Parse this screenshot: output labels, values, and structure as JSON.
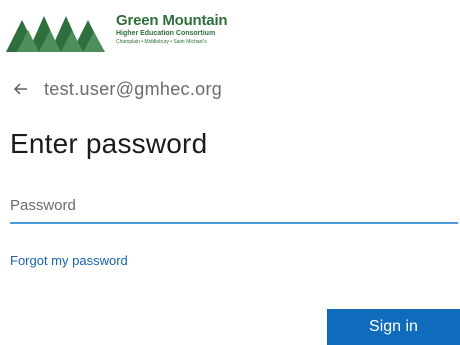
{
  "logo": {
    "name": "Green Mountain",
    "subtitle": "Higher Education Consortium",
    "tagline": "Champlain • Middlebury • Saint Michael's",
    "color": "#2f6e3d"
  },
  "identity": {
    "back_icon": "arrow-left",
    "email": "test.user@gmhec.org"
  },
  "title": "Enter password",
  "password": {
    "placeholder": "Password",
    "value": ""
  },
  "forgot_link": "Forgot my password",
  "signin_button": "Sign in",
  "colors": {
    "accent": "#0f6cbd",
    "link": "#1a64b0",
    "input_underline": "#4f9ad8"
  }
}
